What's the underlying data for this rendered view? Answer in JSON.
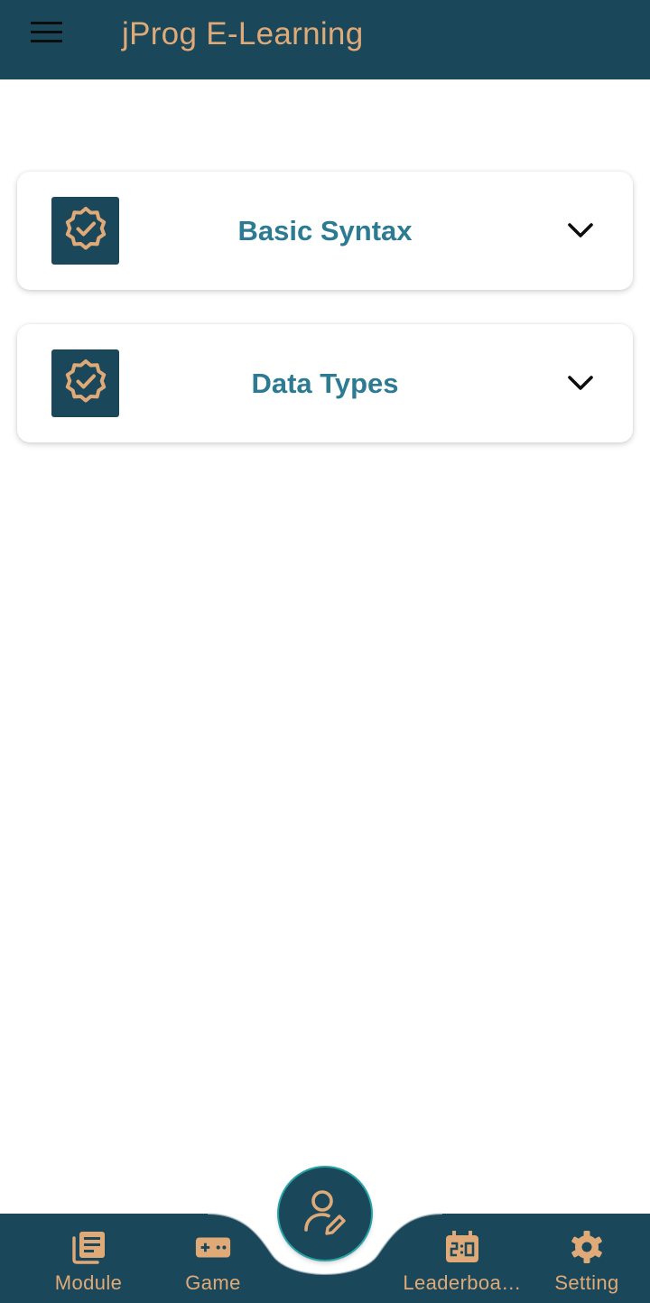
{
  "app_bar": {
    "title": "jProg E-Learning",
    "menu_icon": "hamburger-menu-icon"
  },
  "modules": [
    {
      "title": "Basic Syntax",
      "icon": "verified-badge-icon",
      "expand_icon": "chevron-down-icon"
    },
    {
      "title": "Data Types",
      "icon": "verified-badge-icon",
      "expand_icon": "chevron-down-icon"
    }
  ],
  "bottom_nav": {
    "items": [
      {
        "label": "Module",
        "icon": "module-icon"
      },
      {
        "label": "Game",
        "icon": "gamepad-icon"
      },
      {
        "label": "Leaderboa…",
        "icon": "scoreboard-icon"
      },
      {
        "label": "Setting",
        "icon": "gear-icon"
      }
    ],
    "fab_icon": "edit-profile-icon"
  },
  "colors": {
    "primary": "#1a4759",
    "accent": "#e0aa78",
    "card_title": "#2c7b93",
    "fab_ring": "#27a3a8"
  }
}
